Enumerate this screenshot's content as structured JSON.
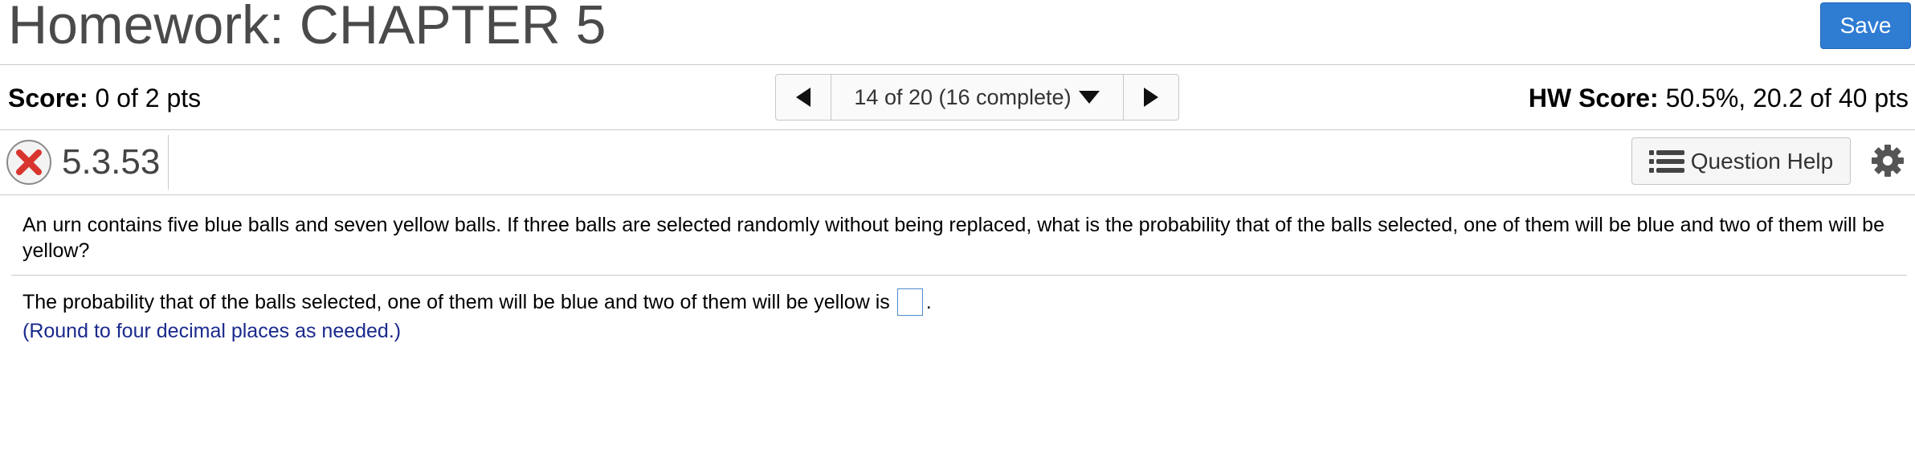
{
  "header": {
    "title": "Homework: CHAPTER 5",
    "save_label": "Save"
  },
  "status": {
    "score_label": "Score:",
    "score_value": "0 of 2 pts",
    "hw_score_label": "HW Score:",
    "hw_score_value": "50.5%, 20.2 of 40 pts"
  },
  "navigator": {
    "position_label": "14 of 20 (16 complete)"
  },
  "question_header": {
    "number": "5.3.53",
    "help_label": "Question Help",
    "status_icon": "incorrect-x-icon"
  },
  "question": {
    "prompt": "An urn contains five blue balls and seven yellow balls. If three balls are selected randomly without being replaced, what is the probability that of the balls selected, one of them will be blue and two of them will be yellow?",
    "answer_lead": "The probability that of the balls selected, one of them will be blue and two of them will be yellow is",
    "answer_value": "",
    "answer_trail": ".",
    "hint": "(Round to four decimal places as needed.)"
  },
  "colors": {
    "accent": "#2f7cd3",
    "error": "#d9352f",
    "hint": "#1a2a8c"
  }
}
